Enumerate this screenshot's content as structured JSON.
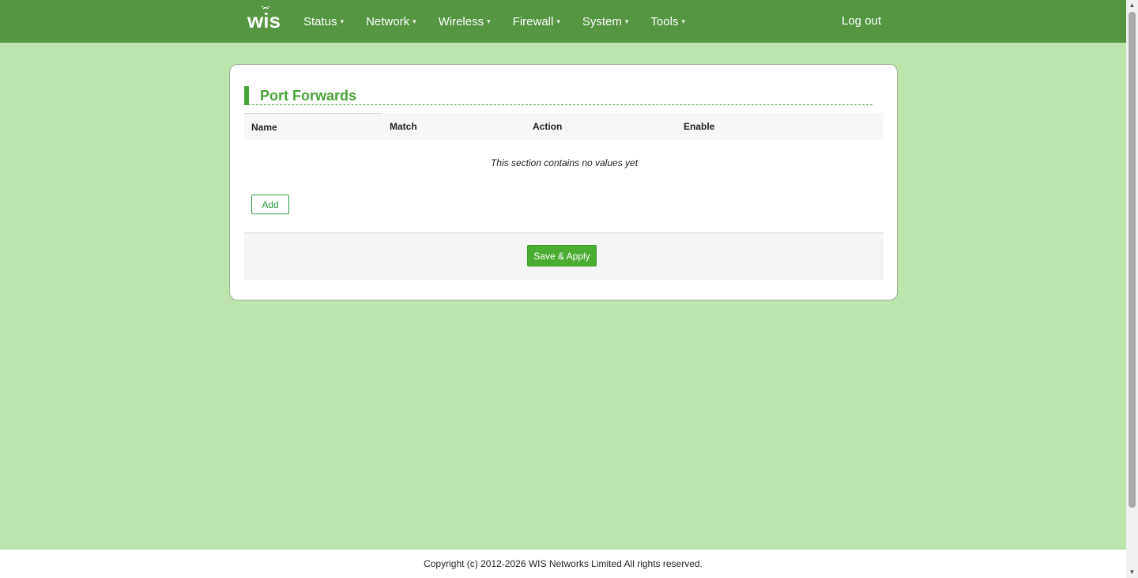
{
  "header": {
    "logo_text": "wis",
    "nav": [
      {
        "label": "Status"
      },
      {
        "label": "Network"
      },
      {
        "label": "Wireless"
      },
      {
        "label": "Firewall"
      },
      {
        "label": "System"
      },
      {
        "label": "Tools"
      }
    ],
    "logout_label": "Log out"
  },
  "section": {
    "title": "Port Forwards",
    "columns": [
      "Name",
      "Match",
      "Action",
      "Enable"
    ],
    "empty_message": "This section contains no values yet",
    "add_label": "Add"
  },
  "actions": {
    "save_apply_label": "Save & Apply"
  },
  "footer": {
    "copyright": "Copyright (c) 2012-2026 WIS Networks Limited All rights reserved."
  },
  "colors": {
    "header_bg": "#559640",
    "page_bg": "#bde4ad",
    "accent": "#4aa23a"
  }
}
